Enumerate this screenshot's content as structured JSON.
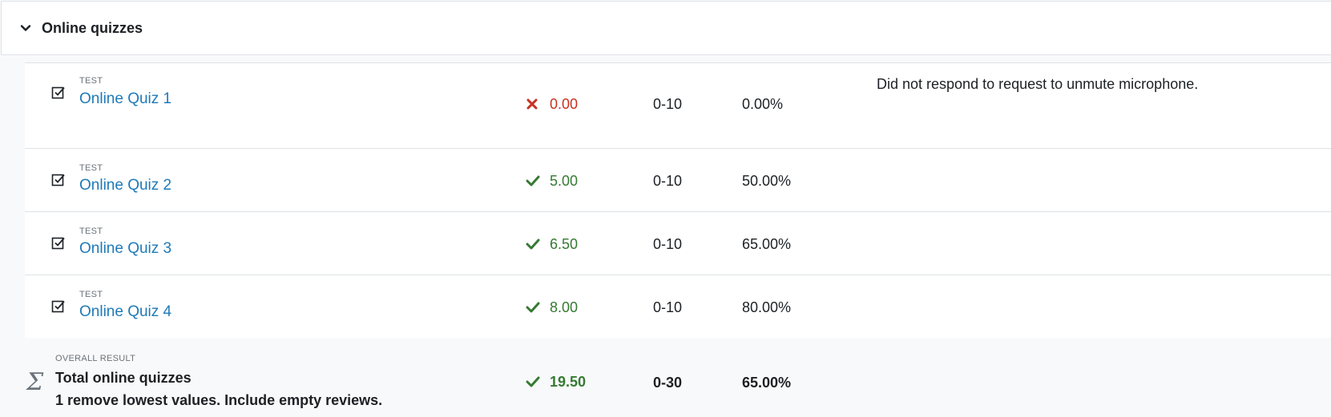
{
  "section": {
    "title": "Online quizzes",
    "chevron_icon": "chevron-down-icon"
  },
  "items": [
    {
      "type": "TEST",
      "name": "Online Quiz 1",
      "status": "fail",
      "grade": "0.00",
      "range": "0-10",
      "percentage": "0.00%",
      "feedback": "Did not respond to request to unmute microphone."
    },
    {
      "type": "TEST",
      "name": "Online Quiz 2",
      "status": "pass",
      "grade": "5.00",
      "range": "0-10",
      "percentage": "50.00%",
      "feedback": ""
    },
    {
      "type": "TEST",
      "name": "Online Quiz 3",
      "status": "pass",
      "grade": "6.50",
      "range": "0-10",
      "percentage": "65.00%",
      "feedback": ""
    },
    {
      "type": "TEST",
      "name": "Online Quiz 4",
      "status": "pass",
      "grade": "8.00",
      "range": "0-10",
      "percentage": "80.00%",
      "feedback": ""
    }
  ],
  "total": {
    "type": "OVERALL RESULT",
    "title": "Total online quizzes",
    "subtitle": "1 remove lowest values. Include empty reviews.",
    "status": "pass",
    "grade": "19.50",
    "range": "0-30",
    "percentage": "65.00%"
  },
  "colors": {
    "link": "#1f7ab8",
    "fail": "#ca3120",
    "pass": "#357a32"
  }
}
